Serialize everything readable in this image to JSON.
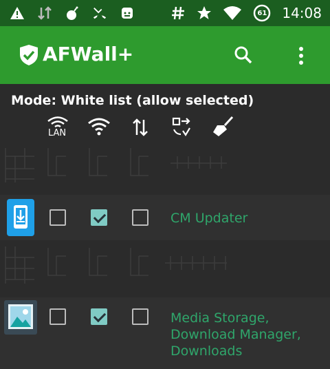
{
  "status_bar": {
    "left_icons": [
      "warning-icon",
      "data-transfer-icon",
      "bomb-icon",
      "missed-call-icon",
      "android-icon"
    ],
    "right_icons": [
      "hash-icon",
      "star-icon",
      "wifi-icon",
      "battery-circle-icon"
    ],
    "battery_level": "61",
    "time": "14:08"
  },
  "app_bar": {
    "title": "AFWall+",
    "background": "#2e9b2e",
    "icons": [
      "shield-check-icon",
      "search-icon",
      "more-vert-icon"
    ]
  },
  "mode_label": "Mode: White list (allow selected)",
  "columns": {
    "lan_label": "LAN",
    "icons": [
      "lan-wifi-icon",
      "wifi-icon",
      "mobile-data-icon",
      "roaming-icon",
      "clean-broom-icon"
    ]
  },
  "apps": [
    {
      "label": "CM Updater",
      "icon": "download-app-icon",
      "lan": false,
      "wifi": true,
      "data": false
    },
    {
      "label": "Media Storage,\nDownload Manager,\nDownloads",
      "label_lines": [
        "Media Storage,",
        "Download Manager,",
        "Downloads"
      ],
      "icon": "image-app-icon",
      "lan": false,
      "wifi": true,
      "data": false
    }
  ],
  "colors": {
    "status_bar": "#1b5e20",
    "accent": "#2fa66b",
    "checkbox_checked": "#80cbc4",
    "background": "#2b2b2b"
  }
}
